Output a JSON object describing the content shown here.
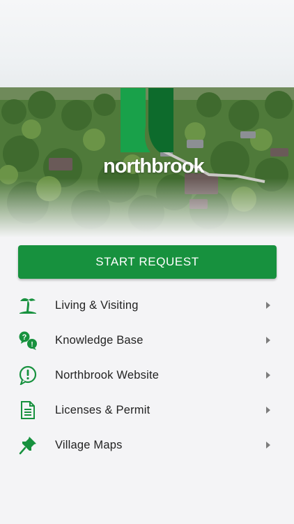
{
  "brand": {
    "wordmark": "northbrook",
    "accent": "#17913e",
    "accent_dark": "#0d6b2c"
  },
  "start_request": {
    "label": "START REQUEST"
  },
  "menu": {
    "items": [
      {
        "label": "Living & Visiting",
        "icon": "palm-tree-icon"
      },
      {
        "label": "Knowledge Base",
        "icon": "question-chat-icon"
      },
      {
        "label": "Northbrook Website",
        "icon": "exclamation-chat-icon"
      },
      {
        "label": "Licenses & Permit",
        "icon": "document-icon"
      },
      {
        "label": "Village Maps",
        "icon": "pushpin-icon"
      }
    ],
    "chevron_icon": "chevron-right-icon"
  }
}
